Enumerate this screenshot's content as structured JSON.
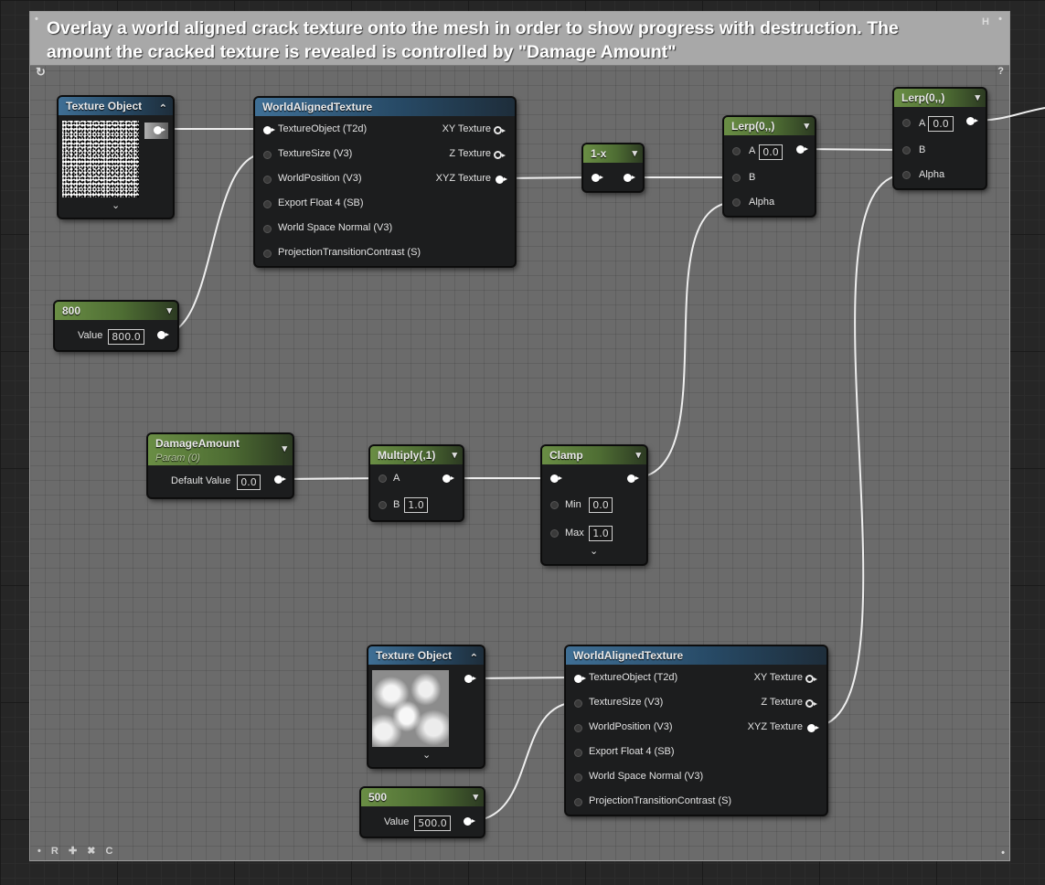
{
  "comment": {
    "title": "Overlay a world aligned crack texture onto the mesh in order to show progress with destruction.  The amount the cracked texture is revealed is controlled by \"Damage Amount\"",
    "corner_dot_left": "•",
    "corner_h": "H",
    "corner_dot_right": "•",
    "refresh_glyph": "↻",
    "help_glyph": "?",
    "footer": [
      "•",
      "R",
      "✚",
      "✖",
      "C"
    ],
    "footer_dot_right": "•"
  },
  "nodes": {
    "texobj1": {
      "title": "Texture Object"
    },
    "wat1": {
      "title": "WorldAlignedTexture",
      "inputs": [
        "TextureObject (T2d)",
        "TextureSize (V3)",
        "WorldPosition (V3)",
        "Export Float 4 (SB)",
        "World Space Normal (V3)",
        "ProjectionTransitionContrast (S)"
      ],
      "outputs": [
        "XY Texture",
        "Z Texture",
        "XYZ Texture"
      ]
    },
    "const800": {
      "title": "800",
      "value_label": "Value",
      "value": "800.0"
    },
    "oneminus": {
      "title": "1-x"
    },
    "lerp1": {
      "title": "Lerp(0,,)",
      "a_label": "A",
      "a_value": "0.0",
      "b_label": "B",
      "alpha_label": "Alpha"
    },
    "lerp2": {
      "title": "Lerp(0,,)",
      "a_label": "A",
      "a_value": "0.0",
      "b_label": "B",
      "alpha_label": "Alpha"
    },
    "damage": {
      "title": "DamageAmount",
      "subtitle": "Param (0)",
      "value_label": "Default Value",
      "value": "0.0"
    },
    "multiply": {
      "title": "Multiply(,1)",
      "a_label": "A",
      "b_label": "B",
      "b_value": "1.0"
    },
    "clamp": {
      "title": "Clamp",
      "min_label": "Min",
      "min_value": "0.0",
      "max_label": "Max",
      "max_value": "1.0"
    },
    "texobj2": {
      "title": "Texture Object"
    },
    "wat2": {
      "title": "WorldAlignedTexture",
      "inputs": [
        "TextureObject (T2d)",
        "TextureSize (V3)",
        "WorldPosition (V3)",
        "Export Float 4 (SB)",
        "World Space Normal (V3)",
        "ProjectionTransitionContrast (S)"
      ],
      "outputs": [
        "XY Texture",
        "Z Texture",
        "XYZ Texture"
      ]
    },
    "const500": {
      "title": "500",
      "value_label": "Value",
      "value": "500.0"
    }
  },
  "glyphs": {
    "chevron_down": "⌄",
    "chevron_up": "⌃",
    "menu_chevron": "▾"
  },
  "colors": {
    "header_blue": "#3f6f95",
    "header_green": "#6a8e45",
    "comment_bg": "#6b6b6b",
    "comment_header": "#a8a8a8"
  }
}
